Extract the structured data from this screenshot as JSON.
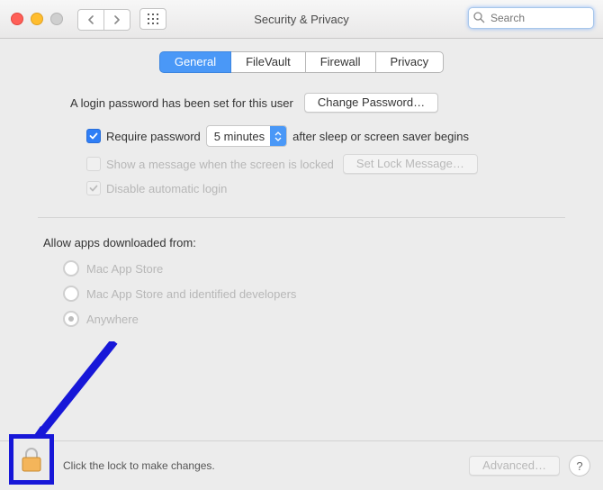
{
  "window": {
    "title": "Security & Privacy"
  },
  "search": {
    "placeholder": "Search"
  },
  "tabs": {
    "general": "General",
    "filevault": "FileVault",
    "firewall": "Firewall",
    "privacy": "Privacy"
  },
  "general": {
    "login_password_text": "A login password has been set for this user",
    "change_password_btn": "Change Password…",
    "require_password_label": "Require password",
    "require_password_delay": "5 minutes",
    "require_password_suffix": "after sleep or screen saver begins",
    "show_message_label": "Show a message when the screen is locked",
    "set_lock_message_btn": "Set Lock Message…",
    "disable_auto_login_label": "Disable automatic login"
  },
  "allow_apps": {
    "heading": "Allow apps downloaded from:",
    "opt_app_store": "Mac App Store",
    "opt_identified": "Mac App Store and identified developers",
    "opt_anywhere": "Anywhere"
  },
  "footer": {
    "lock_message": "Click the lock to make changes.",
    "advanced_btn": "Advanced…",
    "help": "?"
  }
}
